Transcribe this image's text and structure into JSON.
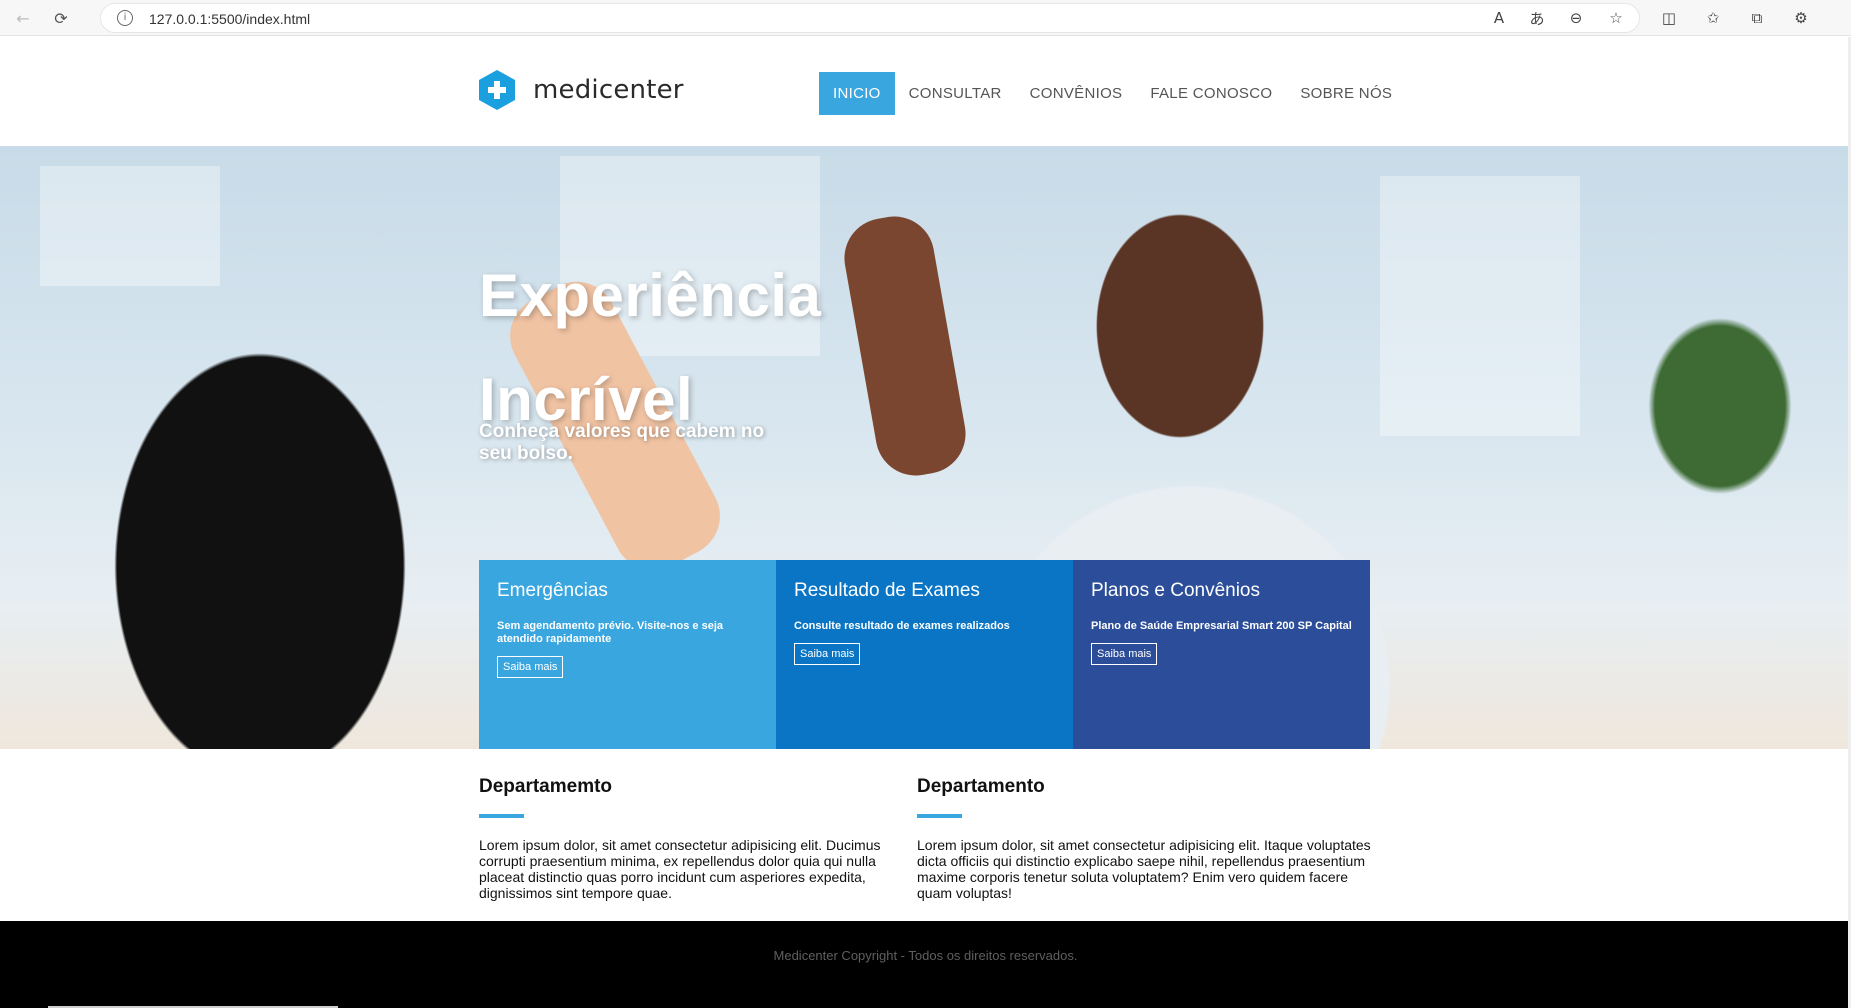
{
  "browser": {
    "url": "127.0.0.1:5500/index.html"
  },
  "header": {
    "logo_text": "medicenter",
    "nav": [
      {
        "label": "INICIO",
        "active": true
      },
      {
        "label": "CONSULTAR",
        "active": false
      },
      {
        "label": "CONVÊNIOS",
        "active": false
      },
      {
        "label": "FALE CONOSCO",
        "active": false
      },
      {
        "label": "SOBRE NÓS",
        "active": false
      }
    ]
  },
  "hero": {
    "title_line1": "Experiência",
    "title_line2": "Incrível",
    "subtitle": "Conheça valores que cabem no seu bolso."
  },
  "cards": [
    {
      "title": "Emergências",
      "text": "Sem agendamento prévio. Visite-nos e seja atendido rapidamente",
      "button": "Saiba mais",
      "color": "#3aa6df"
    },
    {
      "title": "Resultado de Exames",
      "text": "Consulte resultado de exames realizados",
      "button": "Saiba mais",
      "color": "#0a75c4"
    },
    {
      "title": "Planos e Convênios",
      "text": "Plano de Saúde Empresarial Smart 200 SP Capital",
      "button": "Saiba mais",
      "color": "#2c4d99"
    }
  ],
  "departments": [
    {
      "title": "Departamemto",
      "text": "Lorem ipsum dolor, sit amet consectetur adipisicing elit. Ducimus corrupti praesentium minima, ex repellendus dolor quia qui nulla placeat distinctio quas porro incidunt cum asperiores expedita, dignissimos sint tempore quae."
    },
    {
      "title": "Departamento",
      "text": "Lorem ipsum dolor, sit amet consectetur adipisicing elit. Itaque voluptates dicta officiis qui distinctio explicabo saepe nihil, repellendus praesentium maxime corporis tenetur soluta voluptatem? Enim vero quidem facere quam voluptas!"
    }
  ],
  "footer": {
    "text": "Medicenter Copyright - Todos os direitos reservados."
  },
  "colors": {
    "accent": "#3aa6df",
    "card2": "#0a75c4",
    "card3": "#2c4d99",
    "footer_bg": "#000000"
  },
  "icons": [
    "back-arrow-icon",
    "reload-icon",
    "info-icon",
    "read-aloud-icon",
    "translate-icon",
    "zoom-out-icon",
    "favorite-star-icon",
    "split-screen-icon",
    "favorites-icon",
    "collections-icon",
    "extensions-icon",
    "medical-cross-logo-icon"
  ]
}
